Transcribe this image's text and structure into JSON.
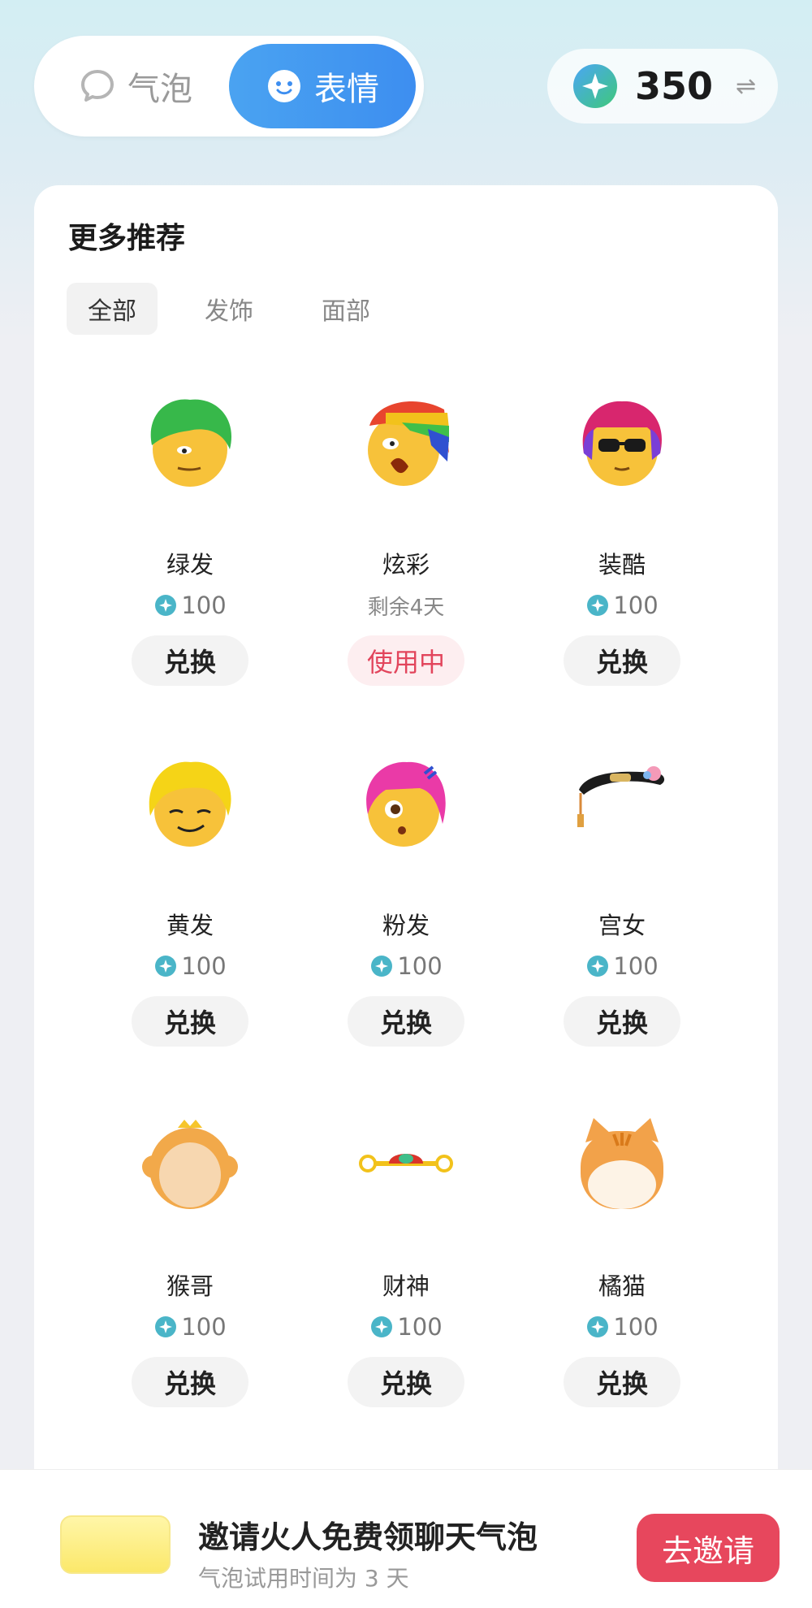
{
  "tabs": {
    "bubble": {
      "label": "气泡",
      "icon": "speech-bubble-icon"
    },
    "emoji": {
      "label": "表情",
      "icon": "smiley-icon"
    }
  },
  "balance": {
    "amount": "350",
    "swap_symbol": "⇌",
    "icon": "gem-icon"
  },
  "section": {
    "title": "更多推荐",
    "filters": [
      "全部",
      "发饰",
      "面部"
    ]
  },
  "items": [
    {
      "name": "绿发",
      "price": "100",
      "action": "兑换",
      "hair": "#37b84a"
    },
    {
      "name": "炫彩",
      "subtitle": "剩余4天",
      "action": "使用中",
      "hair": "#e8452e"
    },
    {
      "name": "装酷",
      "price": "100",
      "action": "兑换",
      "hair": "#d8266e"
    },
    {
      "name": "黄发",
      "price": "100",
      "action": "兑换",
      "hair": "#f5d417"
    },
    {
      "name": "粉发",
      "price": "100",
      "action": "兑换",
      "hair": "#ea3aa7"
    },
    {
      "name": "宫女",
      "price": "100",
      "action": "兑换",
      "hair": "#1c1c1c"
    },
    {
      "name": "猴哥",
      "price": "100",
      "action": "兑换",
      "hair": "#f2a94a"
    },
    {
      "name": "财神",
      "price": "100",
      "action": "兑换",
      "hair": "#d9342b"
    },
    {
      "name": "橘猫",
      "price": "100",
      "action": "兑换",
      "hair": "#f2a24a"
    }
  ],
  "banner": {
    "title": "邀请火人免费领聊天气泡",
    "subtitle": "气泡试用时间为 3 天",
    "button": "去邀请"
  },
  "colors": {
    "accent": "#3d8ef0",
    "danger": "#e7475d"
  }
}
